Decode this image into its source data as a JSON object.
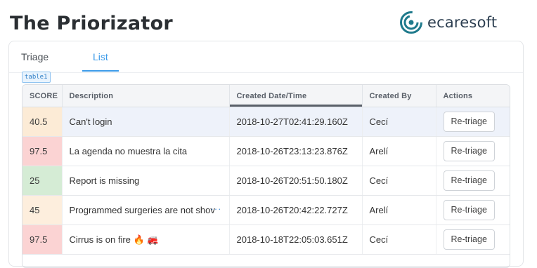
{
  "app": {
    "title": "The Priorizator"
  },
  "brand": {
    "name": "ecaresoft",
    "color": "#1f7a8c"
  },
  "tabs": [
    {
      "label": "Triage",
      "active": false
    },
    {
      "label": "List",
      "active": true
    }
  ],
  "debug_tag": "table1",
  "table": {
    "columns": [
      "SCORE",
      "Description",
      "Created Date/Time",
      "Created By",
      "Actions"
    ],
    "sorted_column": "Created Date/Time",
    "rows": [
      {
        "score": "40.5",
        "score_color": "#fcebd6",
        "description": "Can't login",
        "created": "2018-10-27T02:41:29.160Z",
        "by": "Cecí",
        "action": "Re-triage"
      },
      {
        "score": "97.5",
        "score_color": "#fbd3d3",
        "description": "La agenda no muestra la cita",
        "created": "2018-10-26T23:13:23.876Z",
        "by": "Arelí",
        "action": "Re-triage"
      },
      {
        "score": "25",
        "score_color": "#d5ecd5",
        "description": "Report is missing",
        "created": "2018-10-26T20:51:50.180Z",
        "by": "Cecí",
        "action": "Re-triage"
      },
      {
        "score": "45",
        "score_color": "#fdeedd",
        "description": "Programmed surgeries are not shov",
        "created": "2018-10-26T20:42:22.727Z",
        "by": "Arelí",
        "action": "Re-triage",
        "more": "···"
      },
      {
        "score": "97.5",
        "score_color": "#fbd3d3",
        "description": "Cirrus is on fire 🔥 🚒",
        "created": "2018-10-18T22:05:03.651Z",
        "by": "Cecí",
        "action": "Re-triage"
      }
    ]
  }
}
